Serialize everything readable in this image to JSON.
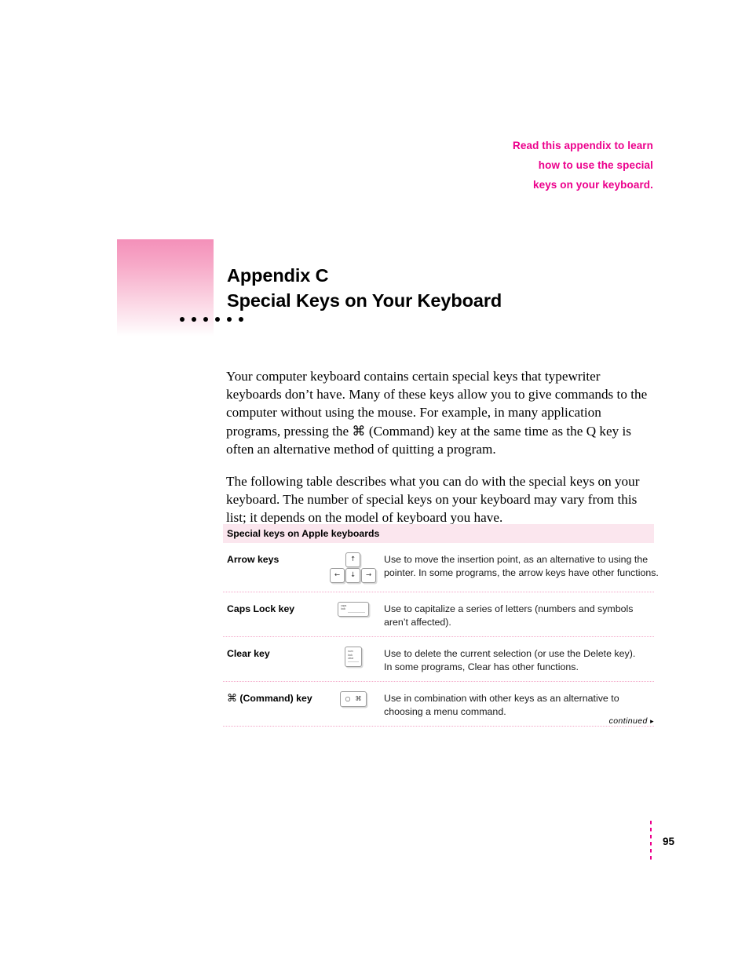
{
  "blurb": {
    "lines": [
      "Read this appendix to learn",
      "how to use the special",
      "keys on your keyboard."
    ],
    "color": "#ec008c"
  },
  "title": {
    "appendix": "Appendix C",
    "name": "Special Keys on Your Keyboard",
    "dot_count": 6,
    "swatch_color_top": "#f490b9",
    "swatch_color_bottom": "#ffffff"
  },
  "body": {
    "paragraph_1": "Your computer keyboard contains certain special keys that typewriter keyboards don’t have. Many of these keys allow you to give commands to the computer without using the mouse. For example, in many application programs, pressing the ⌘ (Command) key at the same time as the Q key is often an alternative method of quitting a program.",
    "paragraph_2": "The following table describes what you can do with the special keys on your keyboard. The number of special keys on your keyboard may vary from this list; it depends on the model of keyboard you have."
  },
  "table": {
    "header": "Special keys on Apple keyboards",
    "header_bg": "#fbe6ee",
    "rule_color": "#f3a7c8",
    "rows": [
      {
        "name": "Arrow keys",
        "icon": "arrow-keys-cluster-icon",
        "keycaps": [
          "↑",
          "←",
          "↓",
          "→"
        ],
        "description_lines": [
          "Use to move the insertion point, as an alternative to using the",
          "pointer. In some programs, the arrow keys have other functions."
        ]
      },
      {
        "name": "Caps Lock key",
        "icon": "caps-lock-key-icon",
        "keycap_label_lines": [
          "caps",
          "lock"
        ],
        "description_lines": [
          "Use to capitalize a series of letters (numbers and symbols",
          "aren’t affected)."
        ]
      },
      {
        "name": "Clear key",
        "icon": "clear-key-icon",
        "keycap_label_lines": [
          "num",
          "lock",
          "clear"
        ],
        "description_lines": [
          "Use to delete the current selection (or use  the Delete key).",
          "In some programs, Clear has other functions."
        ]
      },
      {
        "name_prefix": "⌘",
        "name": " (Command) key",
        "icon": "command-key-icon",
        "keycap_glyphs": [
          "○",
          "⌘"
        ],
        "description_lines": [
          "Use in combination with other keys as an alternative to",
          "choosing a menu command."
        ]
      }
    ]
  },
  "footer": {
    "continued_label": "continued",
    "continued_marker": "▸",
    "page_number": "95",
    "rule_color": "#ec008c"
  }
}
